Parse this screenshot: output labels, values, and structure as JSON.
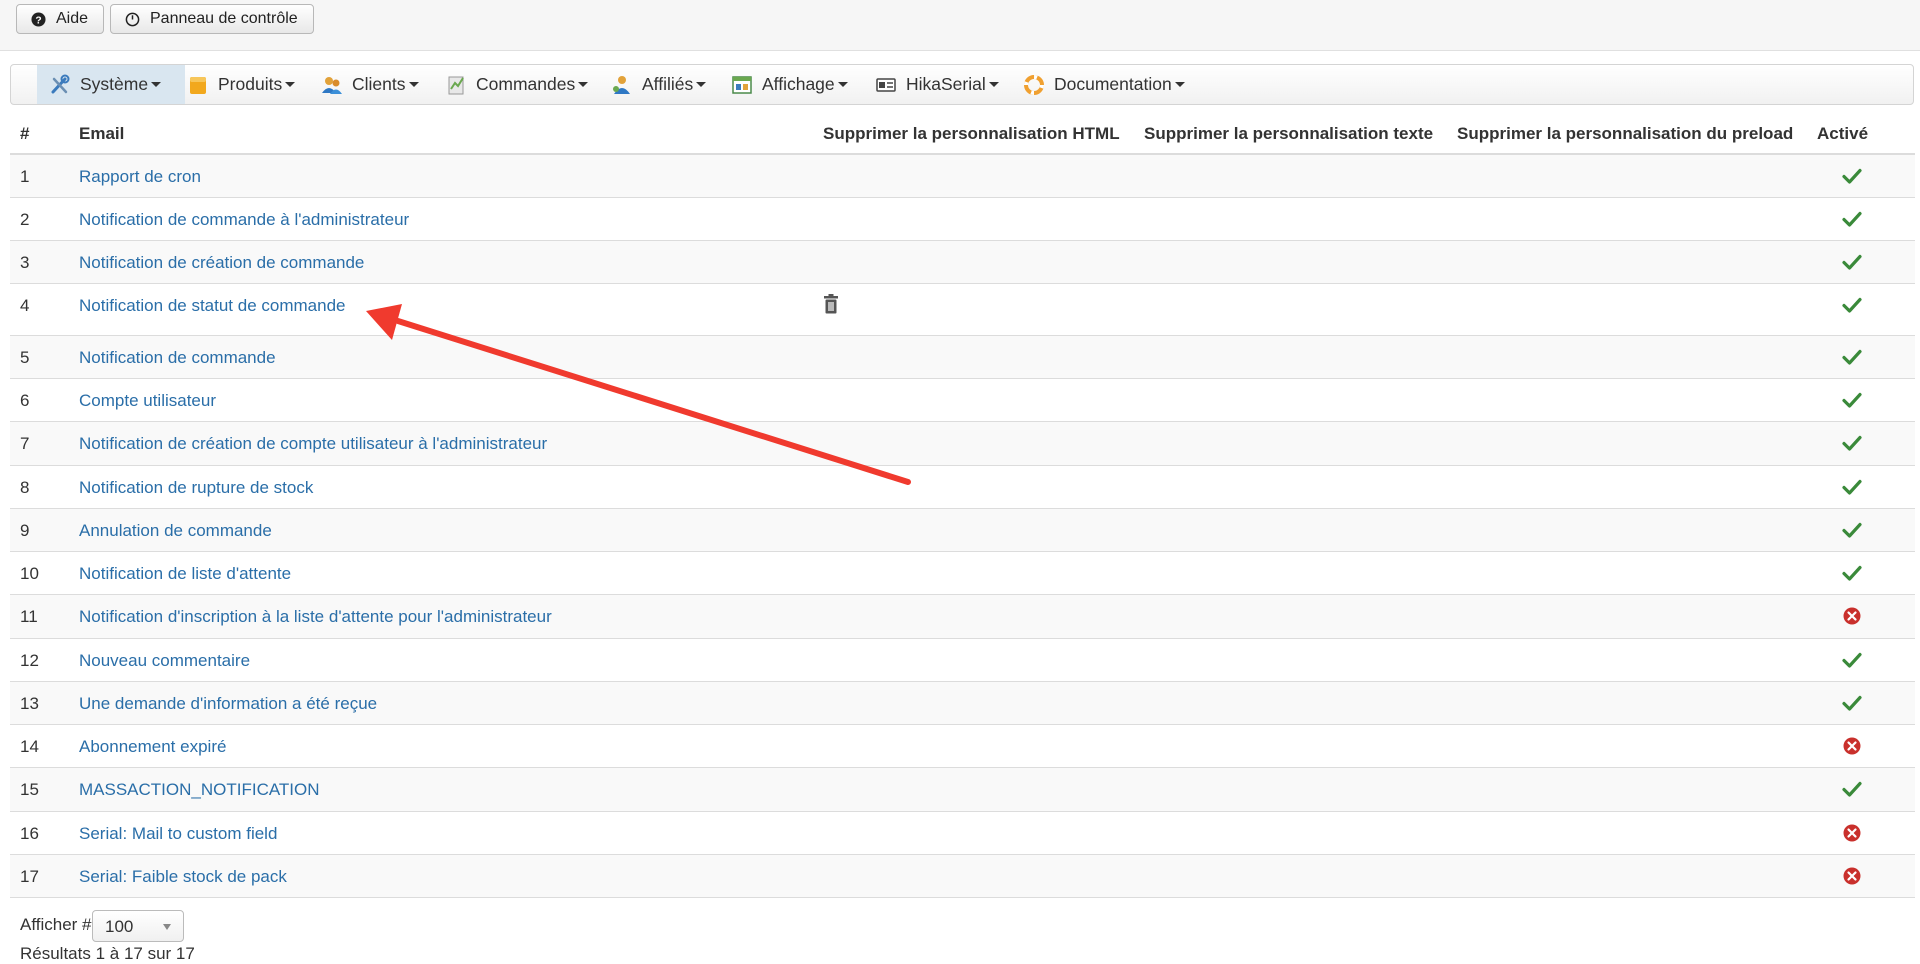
{
  "toolbar": {
    "help_label": "Aide",
    "control_panel_label": "Panneau de contrôle"
  },
  "menu": {
    "items": [
      {
        "label": "Système",
        "icon": "tools-icon"
      },
      {
        "label": "Produits",
        "icon": "products-icon"
      },
      {
        "label": "Clients",
        "icon": "customers-icon"
      },
      {
        "label": "Commandes",
        "icon": "orders-icon"
      },
      {
        "label": "Affiliés",
        "icon": "affiliates-icon"
      },
      {
        "label": "Affichage",
        "icon": "display-icon"
      },
      {
        "label": "HikaSerial",
        "icon": "serial-icon"
      },
      {
        "label": "Documentation",
        "icon": "documentation-icon"
      }
    ]
  },
  "table": {
    "headers": {
      "num": "#",
      "email": "Email",
      "del_html": "Supprimer la personnalisation HTML",
      "del_text": "Supprimer la personnalisation texte",
      "del_preload": "Supprimer la personnalisation du preload",
      "active": "Activé"
    },
    "rows": [
      {
        "num": "1",
        "email": "Rapport de cron",
        "active": true
      },
      {
        "num": "2",
        "email": "Notification de commande à l'administrateur",
        "active": true
      },
      {
        "num": "3",
        "email": "Notification de création de commande",
        "active": true
      },
      {
        "num": "4",
        "email": "Notification de statut de commande",
        "active": true,
        "html_custom": true
      },
      {
        "num": "5",
        "email": "Notification de commande",
        "active": true
      },
      {
        "num": "6",
        "email": "Compte utilisateur",
        "active": true
      },
      {
        "num": "7",
        "email": "Notification de création de compte utilisateur à l'administrateur",
        "active": true
      },
      {
        "num": "8",
        "email": "Notification de rupture de stock",
        "active": true
      },
      {
        "num": "9",
        "email": "Annulation de commande",
        "active": true
      },
      {
        "num": "10",
        "email": "Notification de liste d'attente",
        "active": true
      },
      {
        "num": "11",
        "email": "Notification d'inscription à la liste d'attente pour l'administrateur",
        "active": false
      },
      {
        "num": "12",
        "email": "Nouveau commentaire",
        "active": true
      },
      {
        "num": "13",
        "email": "Une demande d'information a été reçue",
        "active": true
      },
      {
        "num": "14",
        "email": "Abonnement expiré",
        "active": false
      },
      {
        "num": "15",
        "email": "MASSACTION_NOTIFICATION",
        "active": true
      },
      {
        "num": "16",
        "email": "Serial: Mail to custom field",
        "active": false
      },
      {
        "num": "17",
        "email": "Serial: Faible stock de pack",
        "active": false
      }
    ]
  },
  "footer": {
    "display_label": "Afficher #",
    "display_value": "100",
    "results_text": "Résultats 1 à 17 sur 17"
  },
  "colors": {
    "link": "#2a6ea8",
    "active_green": "#3a8a3a",
    "inactive_red": "#c9302c",
    "annotation_arrow": "#f03a2e"
  }
}
